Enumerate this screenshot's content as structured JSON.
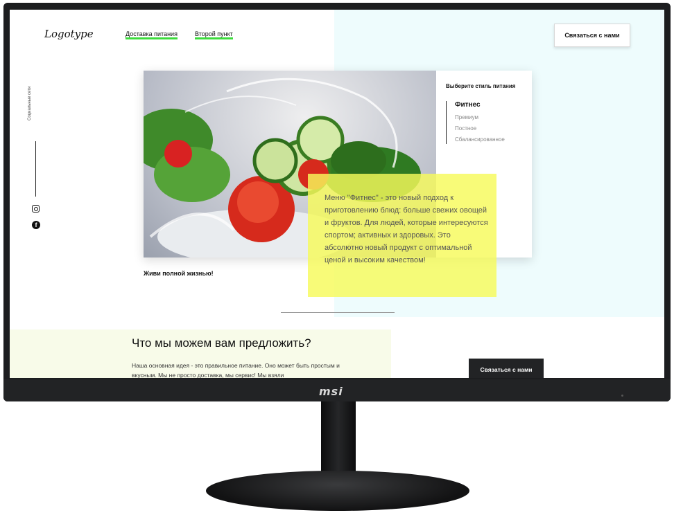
{
  "monitor": {
    "brand": "msi"
  },
  "header": {
    "logo": "Logotype",
    "nav": [
      "Доставка питания",
      "Второй пункт"
    ],
    "contact_button": "Связаться с нами"
  },
  "social": {
    "label": "Социальные сети"
  },
  "hero": {
    "style_title": "Выберите стиль питания",
    "styles": [
      "Фитнес",
      "Премиум",
      "Постное",
      "Сбалансированное"
    ],
    "active_style": "Фитнес",
    "description": "Меню \"Фитнес\" - это новый подход к приготовлению блюд: больше свежих овощей и фруктов. Для людей, которые интересуются спортом; активных и здоровых. Это абсолютно новый продукт с оптимальной ценой и высоким качеством!",
    "tagline": "Живи полной жизнью!"
  },
  "offer": {
    "title": "Что мы можем вам предложить?",
    "text": "Наша основная идея - это правильное питание. Оно может быть простым и вкусным. Мы не просто доставка, мы сервис! Мы взяли",
    "contact_button": "Связаться с нами"
  },
  "colors": {
    "accent_underline": "#3ddc3d",
    "highlight": "#f6fa5a",
    "tint": "#eefcfd"
  }
}
